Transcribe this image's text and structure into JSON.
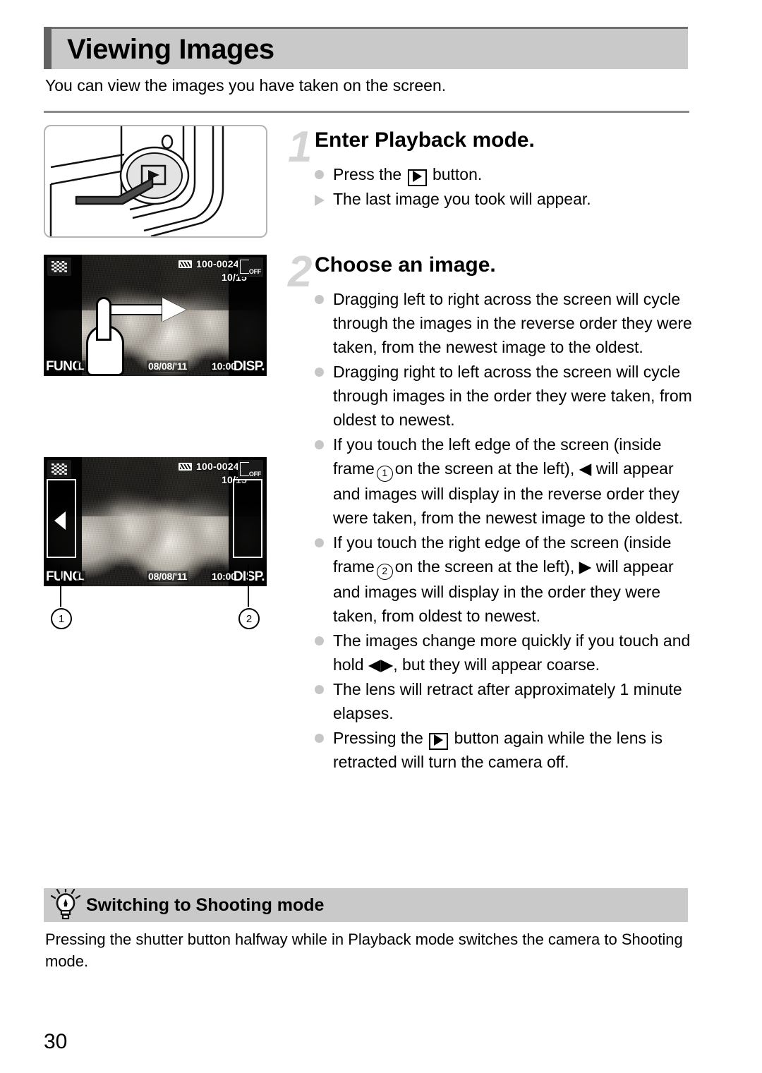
{
  "page": {
    "title": "Viewing Images",
    "intro": "You can view the images you have taken on the screen.",
    "page_number": "30",
    "accent_color": "#636363",
    "header_bg_color": "#c9c9c9",
    "step_number_color": "#d4d4d4",
    "bullet_color": "#c6c6c6"
  },
  "steps": [
    {
      "number": "1",
      "title": "Enter Playback mode.",
      "bullets": [
        {
          "marker": "dot",
          "text_before": "Press the",
          "icon": "playback-button-icon",
          "text_after": "button."
        },
        {
          "marker": "triangle",
          "text_before": "The last image you took will appear.",
          "icon": "",
          "text_after": ""
        }
      ]
    },
    {
      "number": "2",
      "title": "Choose an image.",
      "bullets": [
        {
          "marker": "dot",
          "text_before": "Dragging left to right across the screen will cycle through the images in the reverse order they were taken, from the newest image to the oldest.",
          "icon": "",
          "text_after": ""
        },
        {
          "marker": "dot",
          "text_before": "Dragging right to left across the screen will cycle through images in the order they were taken, from oldest to newest.",
          "icon": "",
          "text_after": ""
        },
        {
          "marker": "dot",
          "text_before": "If you touch the left edge of the screen (inside frame",
          "icon": "circled-1",
          "text_after": "on the screen at the left), ◀ will appear and images will display in the reverse order they were taken, from the newest image to the oldest."
        },
        {
          "marker": "dot",
          "text_before": "If you touch the right edge of the screen (inside frame",
          "icon": "circled-2",
          "text_after": "on the screen at the left), ▶ will appear and images will display in the order they were taken, from oldest to newest."
        },
        {
          "marker": "dot",
          "text_before": "The images change more quickly if you touch and hold ◀▶, but they will appear coarse.",
          "icon": "",
          "text_after": ""
        },
        {
          "marker": "dot",
          "text_before": "The lens will retract after approximately 1 minute elapses.",
          "icon": "",
          "text_after": ""
        },
        {
          "marker": "dot",
          "text_before": "Pressing the",
          "icon": "playback-button-icon",
          "text_after": "button again while the lens is retracted will turn the camera off."
        }
      ]
    }
  ],
  "figures": {
    "camera_button": {
      "caption": "",
      "icon": "playback-button-on-camera-body"
    },
    "lcd_screen_1": {
      "battery": "battery-icon",
      "folder_file": "100-0024",
      "counter": "10/15",
      "movie_icon_label": "OFF",
      "func_label": "FUNC.",
      "quality_label": "L",
      "date": "08/08/'11",
      "time": "10:00",
      "disp_label": "DISP.",
      "gesture": "drag-right-arrow-with-hand"
    },
    "lcd_screen_2": {
      "battery": "battery-icon",
      "folder_file": "100-0024",
      "counter": "10/15",
      "movie_icon_label": "OFF",
      "func_label": "FUNC.",
      "quality_label": "L",
      "date": "08/08/'11",
      "time": "10:00",
      "disp_label": "DISP.",
      "left_arrow_glyph": "left-triangle",
      "callout_1": "1",
      "callout_2": "2"
    }
  },
  "tip": {
    "title": "Switching to Shooting mode",
    "icon": "lightbulb-icon",
    "body": "Pressing the shutter button halfway while in Playback mode switches the camera to Shooting mode."
  }
}
